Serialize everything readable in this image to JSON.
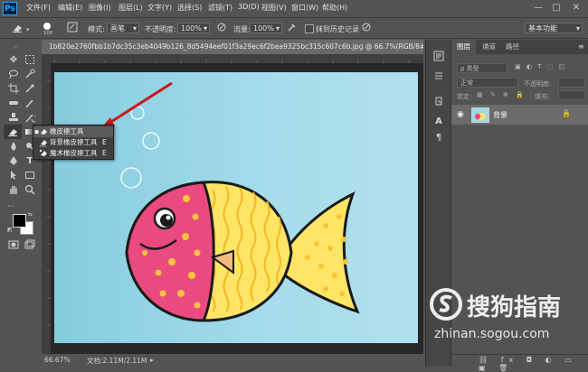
{
  "app": {
    "logo": "Ps"
  },
  "menu": [
    "文件(F)",
    "编辑(E)",
    "图像(I)",
    "图层(L)",
    "文字(Y)",
    "选择(S)",
    "滤镜(T)",
    "3D(D)",
    "视图(V)",
    "窗口(W)",
    "帮助(H)"
  ],
  "window_controls": {
    "minimize": "—",
    "maximize": "□",
    "close": "✕"
  },
  "options": {
    "brush_size": "100",
    "mode_label": "模式:",
    "mode_value": "画笔",
    "opacity_label": "不透明度:",
    "opacity_value": "100%",
    "flow_label": "流量:",
    "flow_value": "100%",
    "history_label": "抹到历史记录",
    "workspace": "基本功能"
  },
  "document": {
    "tab_title": "1b820e2760fbb1b7dc35c3eb4049b126_8d5494eef01f3a29ec6f2bea9325bc315c607c6b.jpg @ 66.7%(RGB/8#)",
    "close": "×",
    "zoom": "66.67%",
    "doc_info": "文档:2.11M/2.11M"
  },
  "flyout": {
    "items": [
      {
        "label": "橡皮擦工具",
        "shortcut": "E"
      },
      {
        "label": "背景橡皮擦工具",
        "shortcut": "E"
      },
      {
        "label": "魔术橡皮擦工具",
        "shortcut": "E"
      }
    ]
  },
  "layers_panel": {
    "tabs": [
      "图层",
      "通道",
      "路径"
    ],
    "filter_label": "ρ 类型",
    "blend_mode": "正常",
    "opacity_label": "不透明度:",
    "lock_label": "锁定:",
    "fill_label": "填充:",
    "layer_name": "背景"
  },
  "watermark": {
    "brand": "搜狗指南",
    "url": "zhinan.sogou.com"
  },
  "colors": {
    "accent": "#31a8ff",
    "canvas": "#a6dceb",
    "arrow": "#c8171e"
  }
}
